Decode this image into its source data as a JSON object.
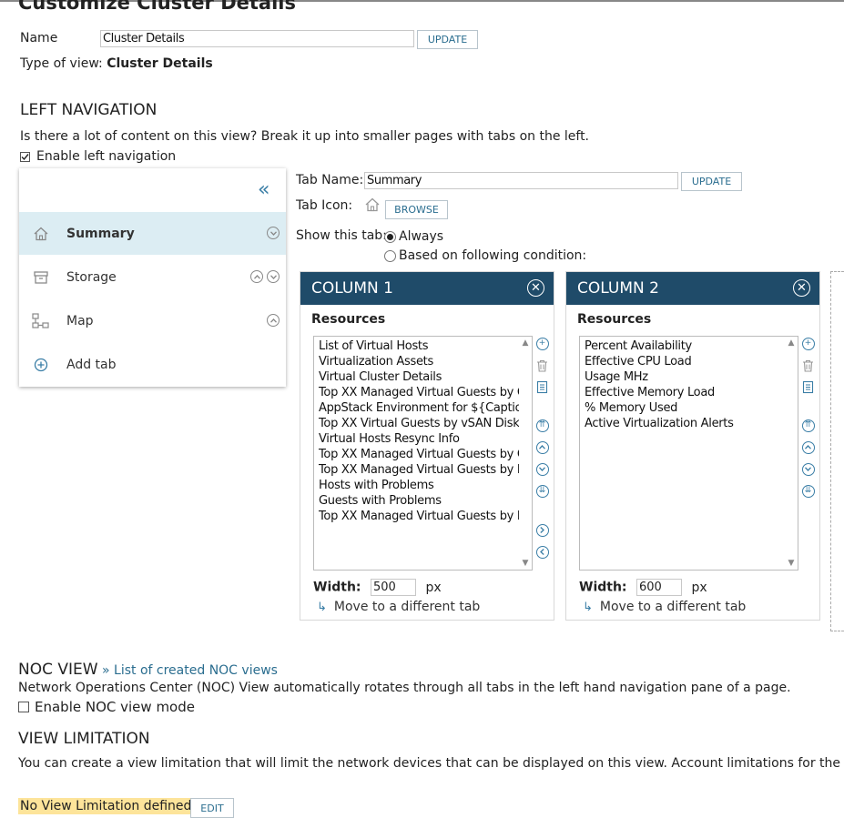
{
  "page": {
    "title": "Customize Cluster Details"
  },
  "name_row": {
    "label": "Name",
    "value": "Cluster Details",
    "button": "UPDATE"
  },
  "type_of_view": {
    "label": "Type of view:",
    "value": "Cluster Details"
  },
  "left_nav": {
    "heading": "LEFT NAVIGATION",
    "description": "Is there a lot of content on this view? Break it up into smaller pages with tabs on the left.",
    "enable_label": "Enable left navigation",
    "enabled": true,
    "collapse_glyph": "«",
    "tabs": [
      {
        "label": "Summary",
        "icon": "home-icon",
        "active": true
      },
      {
        "label": "Storage",
        "icon": "archive-icon",
        "active": false
      },
      {
        "label": "Map",
        "icon": "network-map-icon",
        "active": false
      },
      {
        "label": "Add tab",
        "icon": "plus-circle-icon",
        "active": false
      }
    ]
  },
  "tab_editor": {
    "tab_name_label": "Tab Name:",
    "tab_name_value": "Summary",
    "update_button": "UPDATE",
    "tab_icon_label": "Tab Icon:",
    "browse_button": "BROWSE",
    "show_label": "Show this tab:",
    "show_always": "Always",
    "show_condition": "Based on following condition:",
    "selected": "Always"
  },
  "columns": [
    {
      "title": "COLUMN 1",
      "resources_label": "Resources",
      "resources": [
        "List of Virtual Hosts",
        "Virtualization Assets",
        "Virtual Cluster Details",
        "Top XX Managed Virtual Guests by C",
        "AppStack Environment for ${Captio",
        "Top XX Virtual Guests by vSAN Disk",
        "Virtual Hosts Resync Info",
        "Top XX Managed Virtual Guests by C",
        "Top XX Managed Virtual Guests by F",
        "Hosts with Problems",
        "Guests with Problems",
        "Top XX Managed Virtual Guests by N"
      ],
      "width_label": "Width:",
      "width_value": "500",
      "width_unit": "px",
      "move_label": "Move to a different tab"
    },
    {
      "title": "COLUMN 2",
      "resources_label": "Resources",
      "resources": [
        "Percent Availability",
        "Effective CPU Load",
        "Usage MHz",
        "Effective Memory Load",
        "% Memory Used",
        "Active Virtualization Alerts"
      ],
      "width_label": "Width:",
      "width_value": "600",
      "width_unit": "px",
      "move_label": "Move to a different tab"
    }
  ],
  "noc": {
    "heading": "NOC VIEW",
    "link": "» List of created NOC views",
    "description": "Network Operations Center (NOC) View automatically rotates through all tabs in the left hand navigation pane of a page.",
    "enable_label": "Enable NOC view mode",
    "enabled": false
  },
  "view_limitation": {
    "heading": "VIEW LIMITATION",
    "description": "You can create a view limitation that will limit the network devices that can be displayed on this view. Account limitations for the logged-",
    "status": "No View Limitation defined.",
    "edit_button": "EDIT"
  },
  "colors": {
    "accent": "#2a6d8f",
    "column_header": "#1f4b69",
    "active_tab": "#dcedf3",
    "highlight": "#fde49a"
  }
}
